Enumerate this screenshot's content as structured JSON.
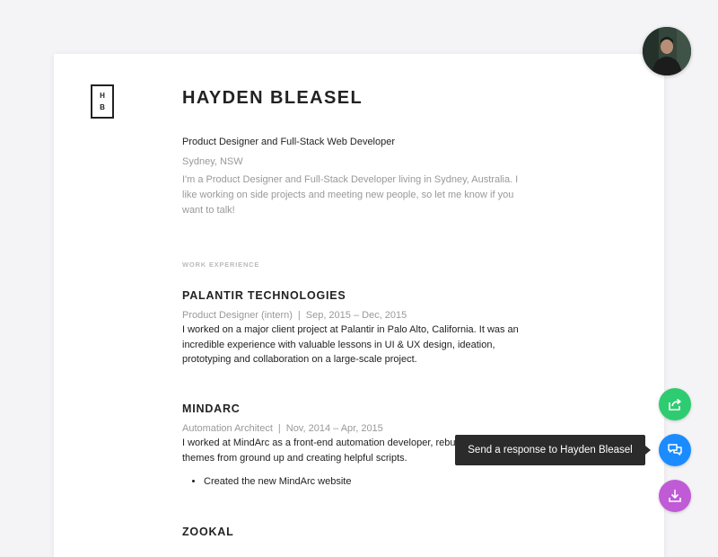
{
  "logo": {
    "line1": "H",
    "line2": "B"
  },
  "profile": {
    "name": "HAYDEN BLEASEL",
    "tagline": "Product Designer and Full-Stack Web Developer",
    "location": "Sydney, NSW",
    "bio": "I'm a Product Designer and Full-Stack Developer living in Sydney, Australia. I like working on side projects and meeting new people, so let me know if you want to talk!"
  },
  "sections": {
    "work_label": "WORK EXPERIENCE"
  },
  "jobs": [
    {
      "company": "PALANTIR TECHNOLOGIES",
      "role": "Product Designer (intern)",
      "separator": "|",
      "dates": "Sep, 2015 – Dec, 2015",
      "description": "I worked on a major client project at Palantir in Palo Alto, California. It was an incredible experience with valuable lessons in UI & UX design, ideation, prototyping and collaboration on a large-scale project."
    },
    {
      "company": "MINDARC",
      "role": "Automation Architect",
      "separator": "|",
      "dates": "Nov, 2014 – Apr, 2015",
      "description": "I worked at MindArc as a front-end automation developer, rebuilding Magento themes from ground up and creating helpful scripts.",
      "bullets": [
        "Created the new MindArc website"
      ]
    },
    {
      "company": "ZOOKAL"
    }
  ],
  "actions": {
    "share": {
      "icon": "share-icon",
      "color": "#2ecc71"
    },
    "respond": {
      "icon": "chat-icon",
      "color": "#1a8cff",
      "tooltip": "Send a response to Hayden Bleasel"
    },
    "download": {
      "icon": "download-icon",
      "color": "#c05ad6"
    }
  }
}
